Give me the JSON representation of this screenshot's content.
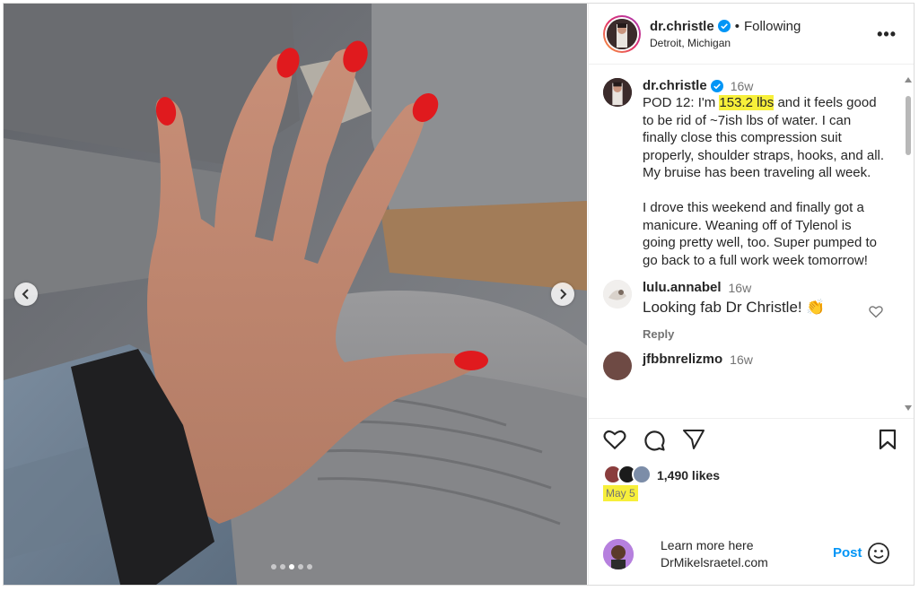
{
  "header": {
    "username": "dr.christle",
    "separator": "•",
    "follow_label": "Following",
    "location": "Detroit, Michigan",
    "more_label": "•••"
  },
  "caption": {
    "username": "dr.christle",
    "time": "16w",
    "text_before": "POD 12: I'm ",
    "highlight": "153.2 lbs",
    "text_after": " and it feels good to be rid of ~7ish lbs of water. I can finally close this compression suit properly, shoulder straps, hooks, and all. My bruise has been traveling all week.",
    "paragraph2": "I drove this weekend and finally got a manicure. Weaning off of Tylenol is going pretty well, too. Super pumped to go back to a full work week tomorrow!"
  },
  "comments": [
    {
      "username": "lulu.annabel",
      "time": "16w",
      "text": "Looking fab Dr Christle! 👏",
      "reply_label": "Reply"
    },
    {
      "username": "jfbbnrelizmo",
      "time": "16w"
    }
  ],
  "stats": {
    "likes": "1,490 likes",
    "date": "May 5"
  },
  "add_comment": {
    "line1": "Learn more here",
    "line2": "DrMikelsraetel.com",
    "post_label": "Post"
  },
  "carousel": {
    "dot_count": 5,
    "active_index": 2
  },
  "colors": {
    "accent": "#0095f6",
    "highlight": "#f7ef3a",
    "verified": "#0095f6",
    "nail": "#e01a1e"
  }
}
